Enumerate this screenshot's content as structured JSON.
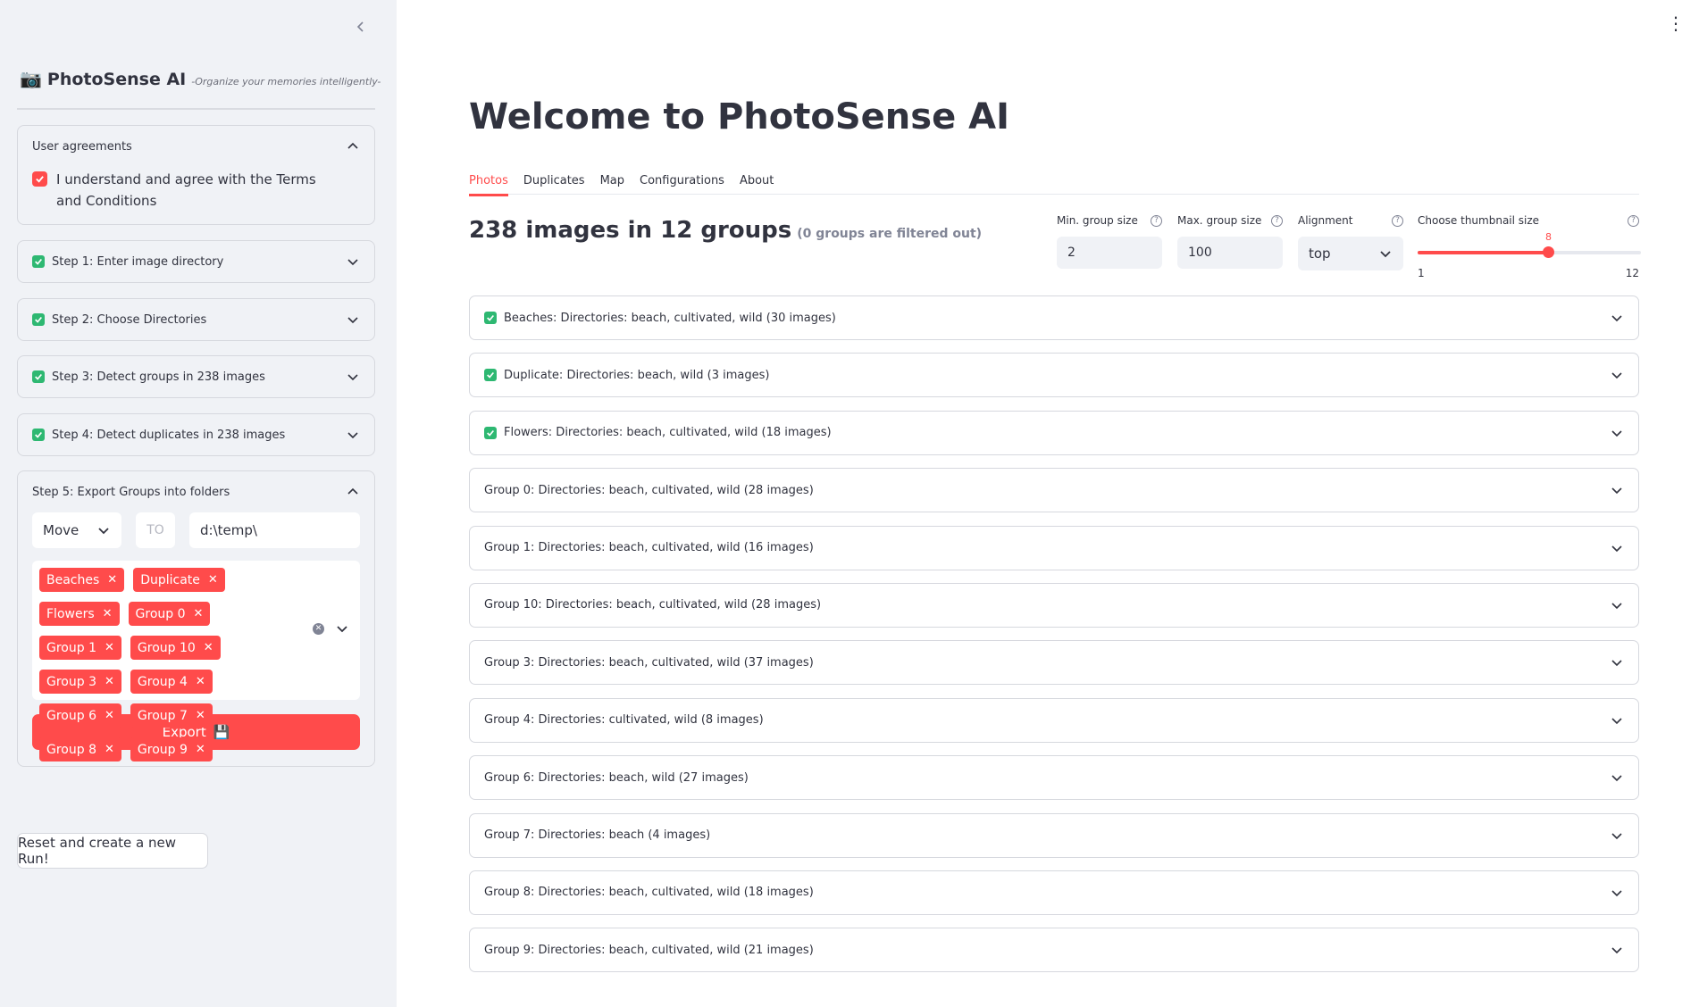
{
  "sidebar": {
    "brand": {
      "icon": "camera-icon",
      "title": "PhotoSense AI",
      "tagline": "-Organize your memories intelligently-"
    },
    "agreements": {
      "title": "User agreements",
      "checkbox_label": "I understand and agree with the Terms and Conditions",
      "checked": true
    },
    "steps": [
      {
        "label": "Step 1: Enter image directory",
        "done": true
      },
      {
        "label": "Step 2: Choose Directories",
        "done": true
      },
      {
        "label": "Step 3: Detect groups in 238 images",
        "done": true
      },
      {
        "label": "Step 4: Detect duplicates in 238 images",
        "done": true
      }
    ],
    "export": {
      "title": "Step 5: Export Groups into folders",
      "mode": "Move",
      "to_placeholder": "TO",
      "path": "d:\\temp\\",
      "tags": [
        "Beaches",
        "Duplicate",
        "Flowers",
        "Group 0",
        "Group 1",
        "Group 10",
        "Group 3",
        "Group 4",
        "Group 6",
        "Group 7",
        "Group 8",
        "Group 9"
      ],
      "button_label": "Export",
      "button_icon": "floppy-disk-icon"
    },
    "reset_label": "Reset and create a new Run!"
  },
  "main": {
    "title": "Welcome to PhotoSense AI",
    "tabs": [
      "Photos",
      "Duplicates",
      "Map",
      "Configurations",
      "About"
    ],
    "active_tab": "Photos",
    "summary": {
      "main": "238 images in 12 groups",
      "note": "(0 groups are filtered out)"
    },
    "controls": {
      "min_group": {
        "label": "Min. group size",
        "value": "2"
      },
      "max_group": {
        "label": "Max. group size",
        "value": "100"
      },
      "alignment": {
        "label": "Alignment",
        "value": "top"
      },
      "thumb": {
        "label": "Choose thumbnail size",
        "value": 8,
        "min": 1,
        "max": 12,
        "value_label": "8",
        "min_label": "1",
        "max_label": "12"
      }
    },
    "groups": [
      {
        "label": "Beaches: Directories: beach, cultivated, wild (30 images)",
        "checked": true
      },
      {
        "label": "Duplicate: Directories: beach, wild (3 images)",
        "checked": true
      },
      {
        "label": "Flowers: Directories: beach, cultivated, wild (18 images)",
        "checked": true
      },
      {
        "label": "Group 0: Directories: beach, cultivated, wild (28 images)",
        "checked": false
      },
      {
        "label": "Group 1: Directories: beach, cultivated, wild (16 images)",
        "checked": false
      },
      {
        "label": "Group 10: Directories: beach, cultivated, wild (28 images)",
        "checked": false
      },
      {
        "label": "Group 3: Directories: beach, cultivated, wild (37 images)",
        "checked": false
      },
      {
        "label": "Group 4: Directories: cultivated, wild (8 images)",
        "checked": false
      },
      {
        "label": "Group 6: Directories: beach, wild (27 images)",
        "checked": false
      },
      {
        "label": "Group 7: Directories: beach (4 images)",
        "checked": false
      },
      {
        "label": "Group 8: Directories: beach, cultivated, wild (18 images)",
        "checked": false
      },
      {
        "label": "Group 9: Directories: beach, cultivated, wild (21 images)",
        "checked": false
      }
    ]
  },
  "colors": {
    "accent": "#ff4b4b",
    "check": "#2eb872",
    "sidebar_bg": "#f0f2f6"
  }
}
